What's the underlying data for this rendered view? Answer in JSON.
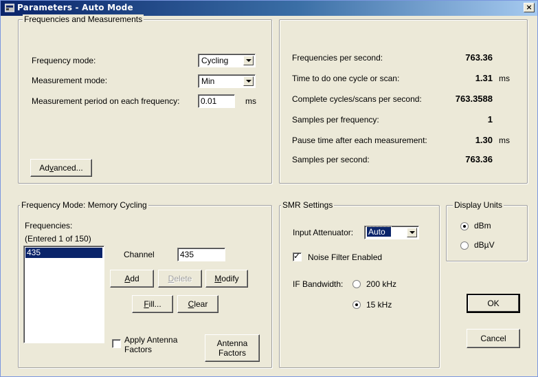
{
  "window": {
    "title": "Parameters - Auto Mode",
    "close": "×"
  },
  "freq_meas": {
    "label": "Frequencies and Measurements",
    "freq_mode_label": "Frequency mode:",
    "freq_mode_value": "Cycling",
    "meas_mode_label": "Measurement mode:",
    "meas_mode_value": "Min",
    "period_label": "Measurement period on each frequency:",
    "period_value": "0.01",
    "period_unit": "ms",
    "advanced_pre": "Ad",
    "advanced_u": "v",
    "advanced_post": "anced..."
  },
  "stats": {
    "rows": [
      {
        "label": "Frequencies per second:",
        "value": "763.36",
        "unit": ""
      },
      {
        "label": "Time to do one cycle or scan:",
        "value": "1.31",
        "unit": "ms"
      },
      {
        "label": "Complete cycles/scans per second:",
        "value": "763.3588",
        "unit": ""
      },
      {
        "label": "Samples per frequency:",
        "value": "1",
        "unit": ""
      },
      {
        "label": "Pause time after each measurement:",
        "value": "1.30",
        "unit": "ms"
      },
      {
        "label": "Samples per second:",
        "value": "763.36",
        "unit": ""
      }
    ]
  },
  "memcyc": {
    "label": "Frequency Mode: Memory Cycling",
    "freqs_label": "Frequencies:",
    "entered": "(Entered  1 of 150)",
    "list_items": [
      "435"
    ],
    "channel_label": "Channel",
    "channel_value": "435",
    "add_u": "A",
    "add_post": "dd",
    "delete_u": "D",
    "delete_post": "elete",
    "modify_u": "M",
    "modify_post": "odify",
    "fill_u": "F",
    "fill_post": "ill...",
    "clear_u": "C",
    "clear_post": "lear",
    "apply_label_1": "Apply Antenna",
    "apply_label_2": "Factors",
    "apply_checked": false,
    "antenna_btn_1": "Antenna",
    "antenna_btn_2": "Factors"
  },
  "smr": {
    "label": "SMR Settings",
    "atten_label": "Input Attenuator:",
    "atten_value": "Auto",
    "noise_label": "Noise Filter Enabled",
    "noise_checked": true,
    "ifbw_label": "IF Bandwidth:",
    "ifbw_opt1": "200 kHz",
    "ifbw_opt2": "15 kHz",
    "ifbw_selected": "15 kHz"
  },
  "units": {
    "label": "Display Units",
    "opt1": "dBm",
    "opt2": "dBµV",
    "selected": "dBm"
  },
  "buttons": {
    "ok": "OK",
    "cancel": "Cancel"
  }
}
